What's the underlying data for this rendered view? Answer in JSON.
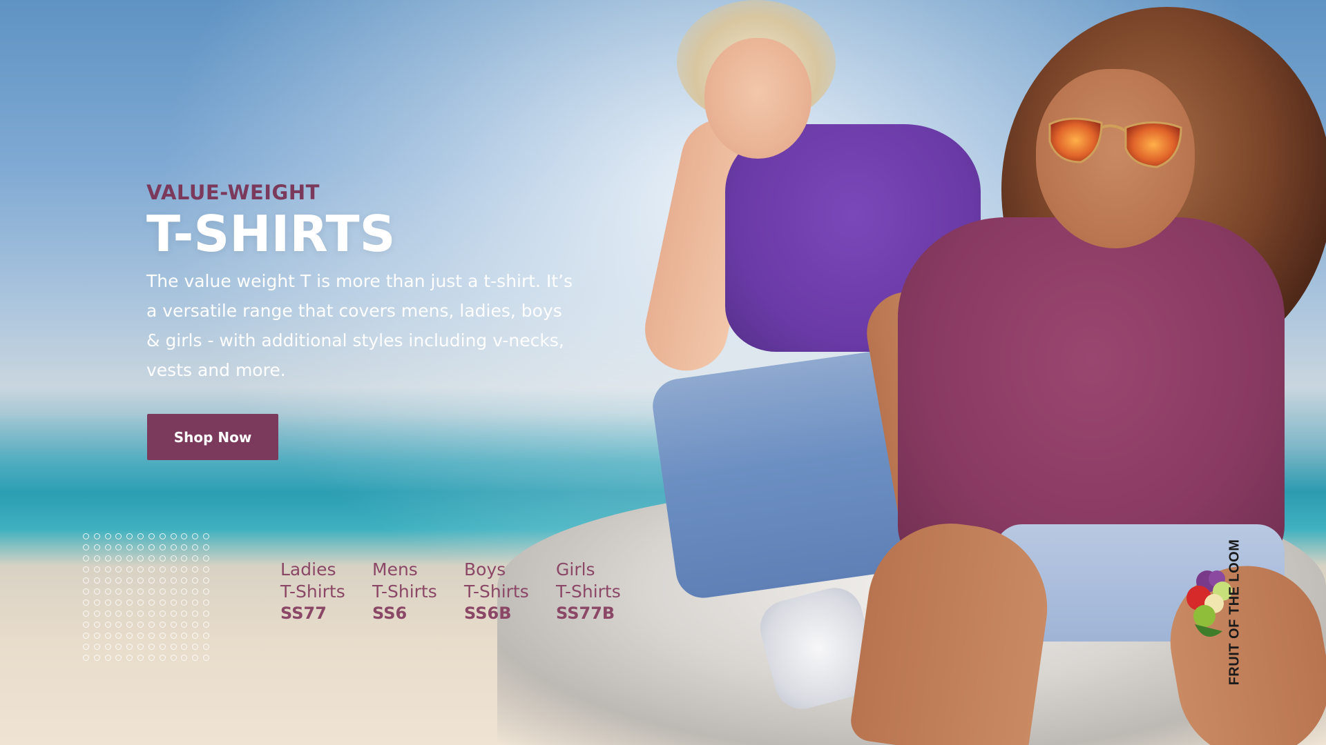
{
  "hero": {
    "eyebrow": "VALUE-WEIGHT",
    "title": "T-SHIRTS",
    "description": "The value weight T is more than just a t-shirt. It’s a versatile range that covers mens, ladies, boys & girls - with additional styles including v-necks, vests and more.",
    "cta_label": "Shop Now"
  },
  "products": [
    {
      "category": "Ladies",
      "type": "T-Shirts",
      "code": "SS77"
    },
    {
      "category": "Mens",
      "type": "T-Shirts",
      "code": "SS6"
    },
    {
      "category": "Boys",
      "type": "T-Shirts",
      "code": "SS6B"
    },
    {
      "category": "Girls",
      "type": "T-Shirts",
      "code": "SS77B"
    }
  ],
  "brand": {
    "logo_text": "FRUIT OF THE LOOM",
    "accent_color": "#7b3a5c"
  },
  "icons": {
    "logo": "fruit-of-the-loom-logo-icon"
  }
}
